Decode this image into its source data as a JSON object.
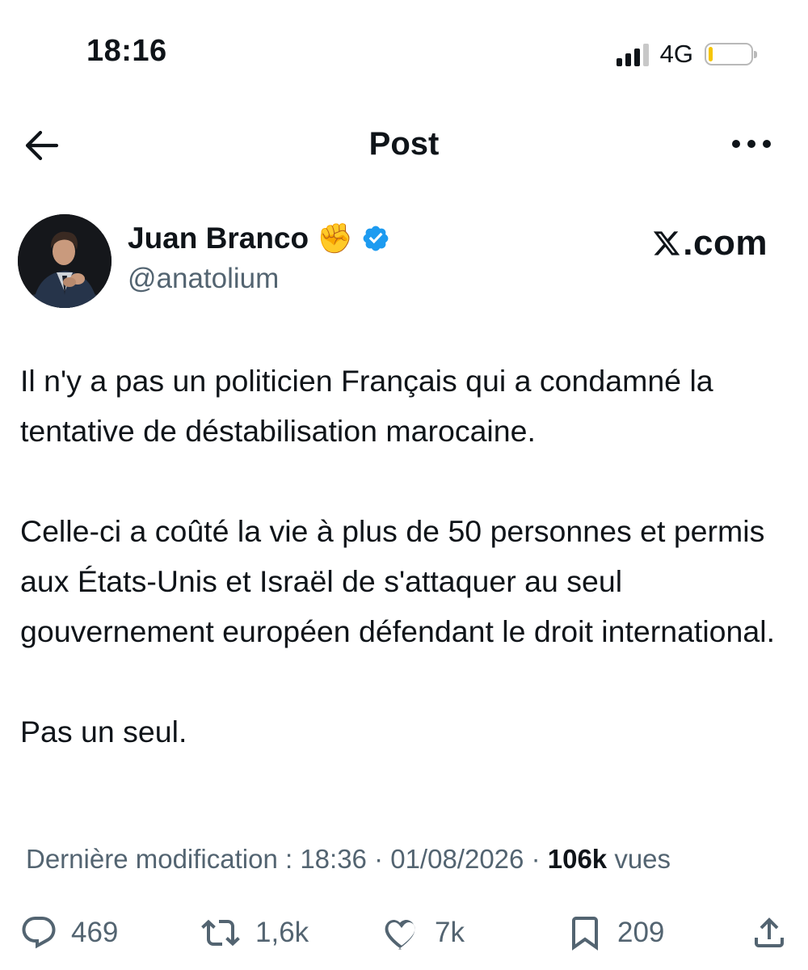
{
  "status_bar": {
    "time": "18:16",
    "network": "4G",
    "battery_level": 0.1,
    "signal_bars": 3
  },
  "header": {
    "title": "Post",
    "back_icon": "arrow-left-icon",
    "more_icon": "more-horizontal-icon"
  },
  "author": {
    "name": "Juan Branco",
    "name_emoji": "✊",
    "verified": true,
    "handle": "@anatolium",
    "avatar_icon": "avatar-photo"
  },
  "watermark": {
    "text": ".com",
    "icon": "x-logo-icon"
  },
  "post": {
    "paragraphs": [
      "Il n'y a pas un politicien Français qui a condamné la tentative de déstabilisation marocaine.",
      "Celle-ci a coûté la vie à plus de 50 personnes et permis aux États-Unis et Israël de s'attaquer au seul gouvernement européen défendant le droit international.",
      "Pas un seul."
    ]
  },
  "meta": {
    "edited_label": "Dernière modification : 18:36 · 01/08/2026",
    "separator": "·",
    "views_count": "106k",
    "views_label": "vues"
  },
  "actions": {
    "replies": "469",
    "reposts": "1,6k",
    "likes": "7k",
    "bookmarks": "209"
  },
  "colors": {
    "text_primary": "#0f1419",
    "text_secondary": "#536471",
    "verified_blue": "#1d9bf0",
    "battery_yellow": "#f6c500"
  }
}
